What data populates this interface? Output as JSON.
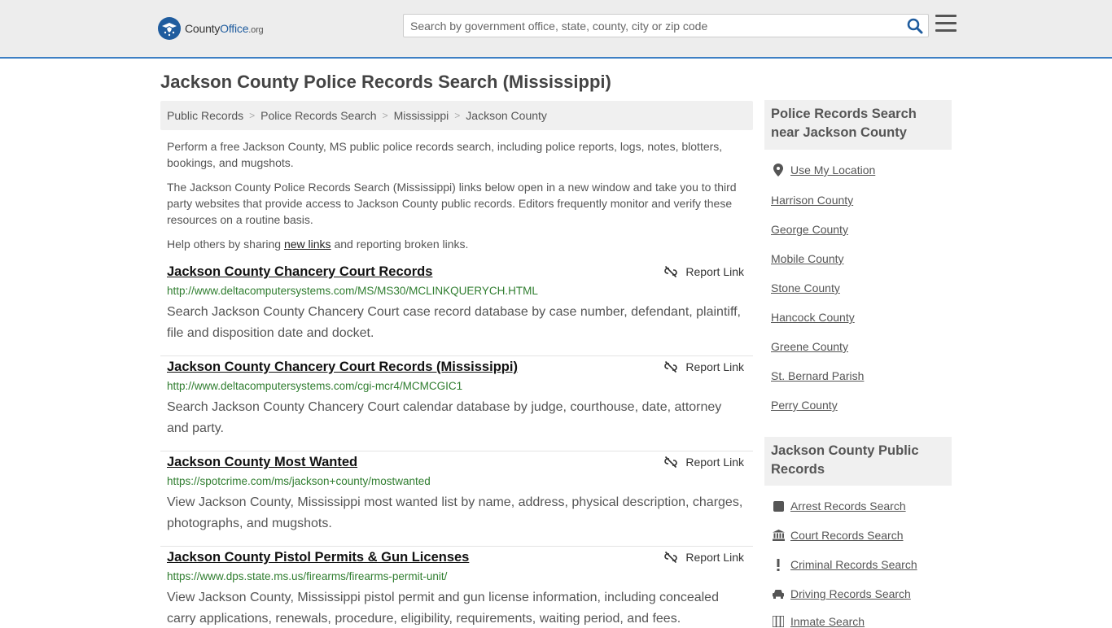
{
  "header": {
    "logo_county": "County",
    "logo_office": "Office",
    "logo_org": ".org",
    "search_placeholder": "Search by government office, state, county, city or zip code"
  },
  "page": {
    "title": "Jackson County Police Records Search (Mississippi)"
  },
  "breadcrumb": [
    "Public Records",
    "Police Records Search",
    "Mississippi",
    "Jackson County"
  ],
  "intro": {
    "p1": "Perform a free Jackson County, MS public police records search, including police reports, logs, notes, blotters, bookings, and mugshots.",
    "p2": "The Jackson County Police Records Search (Mississippi) links below open in a new window and take you to third party websites that provide access to Jackson County public records. Editors frequently monitor and verify these resources on a routine basis.",
    "p3_before": "Help others by sharing ",
    "p3_link": "new links",
    "p3_after": " and reporting broken links."
  },
  "report_label": "Report Link",
  "results": [
    {
      "title": "Jackson County Chancery Court Records",
      "url": "http://www.deltacomputersystems.com/MS/MS30/MCLINKQUERYCH.HTML",
      "desc": "Search Jackson County Chancery Court case record database by case number, defendant, plaintiff, file and disposition date and docket."
    },
    {
      "title": "Jackson County Chancery Court Records (Mississippi)",
      "url": "http://www.deltacomputersystems.com/cgi-mcr4/MCMCGIC1",
      "desc": "Search Jackson County Chancery Court calendar database by judge, courthouse, date, attorney and party."
    },
    {
      "title": "Jackson County Most Wanted",
      "url": "https://spotcrime.com/ms/jackson+county/mostwanted",
      "desc": "View Jackson County, Mississippi most wanted list by name, address, physical description, charges, photographs, and mugshots."
    },
    {
      "title": "Jackson County Pistol Permits & Gun Licenses",
      "url": "https://www.dps.state.ms.us/firearms/firearms-permit-unit/",
      "desc": "View Jackson County, Mississippi pistol permit and gun license information, including concealed carry applications, renewals, procedure, eligibility, requirements, waiting period, and fees."
    }
  ],
  "sidebar": {
    "nearby_heading": "Police Records Search near Jackson County",
    "use_location": "Use My Location",
    "nearby": [
      "Harrison County",
      "George County",
      "Mobile County",
      "Stone County",
      "Hancock County",
      "Greene County",
      "St. Bernard Parish",
      "Perry County"
    ],
    "public_heading": "Jackson County Public Records",
    "public_links": [
      {
        "label": "Arrest Records Search",
        "icon": "square-icon"
      },
      {
        "label": "Court Records Search",
        "icon": "courthouse-icon"
      },
      {
        "label": "Criminal Records Search",
        "icon": "exclamation-icon"
      },
      {
        "label": "Driving Records Search",
        "icon": "car-icon"
      },
      {
        "label": "Inmate Search",
        "icon": "inmate-icon"
      }
    ]
  },
  "colors": {
    "brand_blue": "#1f5c9e",
    "url_green": "#2f7d2f",
    "header_bg": "#ededed",
    "header_border": "#3d7fc4"
  }
}
